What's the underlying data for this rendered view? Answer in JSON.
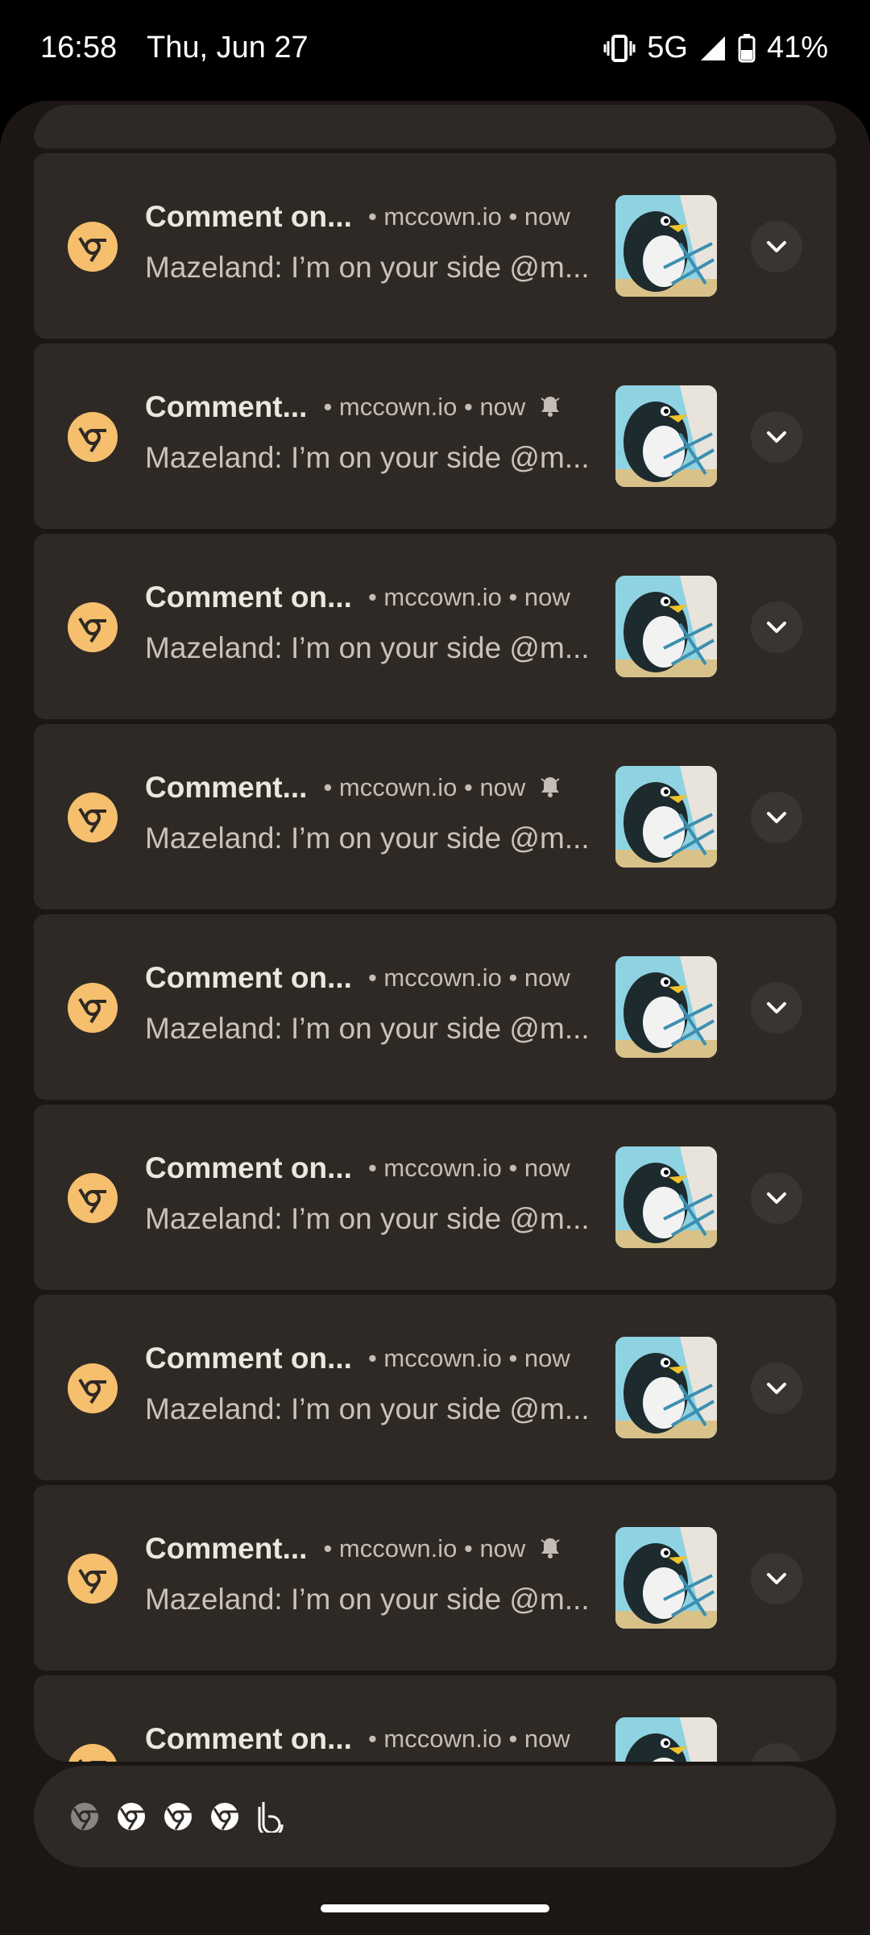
{
  "status_bar": {
    "time": "16:58",
    "date": "Thu, Jun 27",
    "network": "5G",
    "battery": "41%",
    "icons": [
      "vibrate-icon",
      "signal-icon",
      "battery-icon"
    ]
  },
  "notifications": [
    {
      "title": "Comment on...",
      "meta": "• mccown.io • now",
      "text": "Mazeland: I’m on your side @m...",
      "bell": false
    },
    {
      "title": "Comment...",
      "meta": "• mccown.io • now",
      "text": "Mazeland: I’m on your side @m...",
      "bell": true
    },
    {
      "title": "Comment on...",
      "meta": "• mccown.io • now",
      "text": "Mazeland: I’m on your side @m...",
      "bell": false
    },
    {
      "title": "Comment...",
      "meta": "• mccown.io • now",
      "text": "Mazeland: I’m on your side @m...",
      "bell": true
    },
    {
      "title": "Comment on...",
      "meta": "• mccown.io • now",
      "text": "Mazeland: I’m on your side @m...",
      "bell": false
    },
    {
      "title": "Comment on...",
      "meta": "• mccown.io • now",
      "text": "Mazeland: I’m on your side @m...",
      "bell": false
    },
    {
      "title": "Comment on...",
      "meta": "• mccown.io • now",
      "text": "Mazeland: I’m on your side @m...",
      "bell": false
    },
    {
      "title": "Comment...",
      "meta": "• mccown.io • now",
      "text": "Mazeland: I’m on your side @m...",
      "bell": true
    },
    {
      "title": "Comment on...",
      "meta": "• mccown.io • now",
      "text": "",
      "bell": false
    }
  ],
  "overflow_icons": [
    "chrome-icon",
    "chrome-icon",
    "chrome-icon",
    "chrome-icon",
    "app-b-icon"
  ],
  "colors": {
    "shade_bg": "#1c1714",
    "card_bg": "#2e2924",
    "app_icon_bg": "#f5bf6e",
    "thumb_bg": "#8fd3e3"
  }
}
